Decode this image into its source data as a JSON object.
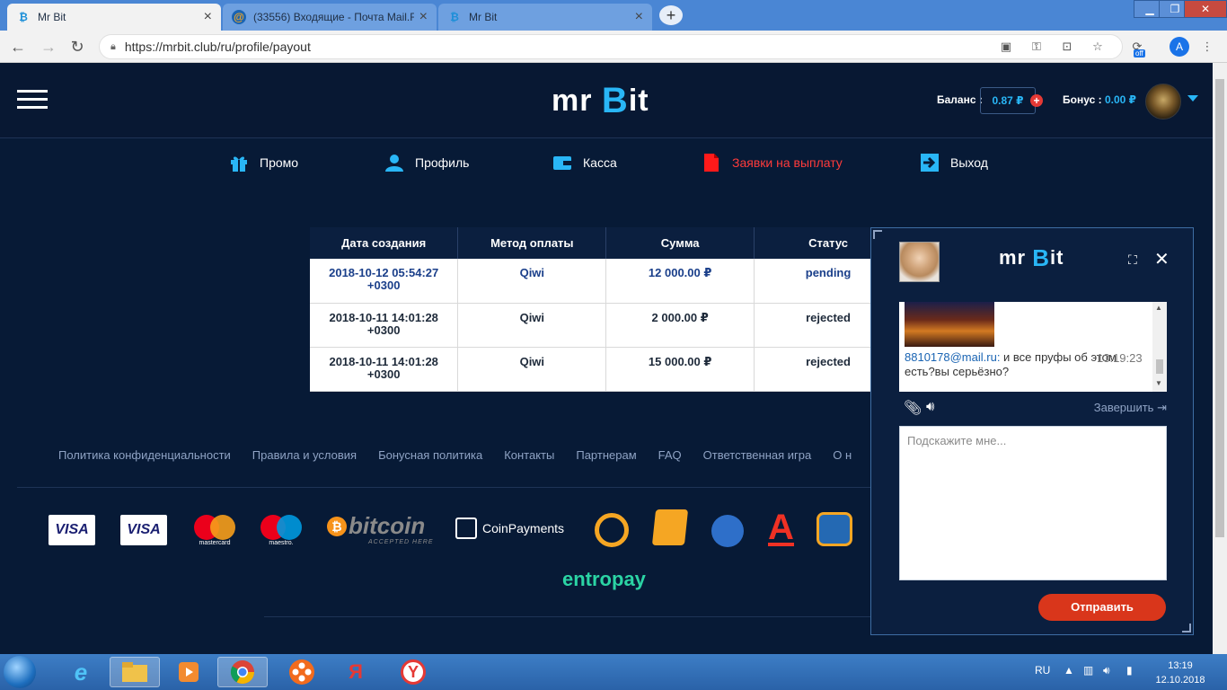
{
  "browser": {
    "tabs": [
      {
        "title": "Mr Bit",
        "icon": "mrbit-favicon",
        "active": true
      },
      {
        "title": "(33556) Входящие - Почта Mail.R",
        "icon": "mail-favicon",
        "active": false
      },
      {
        "title": "Mr Bit",
        "icon": "mrbit-favicon",
        "active": false
      }
    ],
    "url": "https://mrbit.club/ru/profile/payout",
    "profile_initial": "А",
    "ext_badge": "off"
  },
  "header": {
    "logo_prefix": "mr",
    "logo_b": "B",
    "logo_suffix": "it",
    "balance_label": "Баланс :",
    "balance_value": "0.87 ₽",
    "bonus_label": "Бонус :",
    "bonus_value": "0.00 ₽"
  },
  "menu": {
    "items": [
      {
        "label": "Промо",
        "icon": "gift-icon"
      },
      {
        "label": "Профиль",
        "icon": "user-icon"
      },
      {
        "label": "Касса",
        "icon": "wallet-icon"
      },
      {
        "label": "Заявки на выплату",
        "icon": "document-icon",
        "active": true
      },
      {
        "label": "Выход",
        "icon": "logout-icon"
      }
    ],
    "active_color": "#ff3b3b"
  },
  "table": {
    "headers": [
      "Дата создания",
      "Метод оплаты",
      "Сумма",
      "Статус"
    ],
    "rows": [
      {
        "date": "2018-10-12 05:54:27",
        "tz": "+0300",
        "method": "Qiwi",
        "amount": "12 000.00 ₽",
        "status": "pending"
      },
      {
        "date": "2018-10-11 14:01:28",
        "tz": "+0300",
        "method": "Qiwi",
        "amount": "2 000.00 ₽",
        "status": "rejected"
      },
      {
        "date": "2018-10-11 14:01:28",
        "tz": "+0300",
        "method": "Qiwi",
        "amount": "15 000.00 ₽",
        "status": "rejected"
      }
    ]
  },
  "footer": {
    "links": [
      "Политика конфиденциальности",
      "Правила и условия",
      "Бонусная политика",
      "Контакты",
      "Партнерам",
      "FAQ",
      "Ответственная игра",
      "О н"
    ],
    "payment": {
      "visa": "VISA",
      "mastercard": "mastercard",
      "maestro": "maestro.",
      "bitcoin": "bitcoin",
      "bitcoin_sub": "ACCEPTED HERE",
      "coinpayments": "CoinPayments",
      "alfa": "А",
      "entropay": "entropay"
    }
  },
  "chat": {
    "message_sender": "8810178@mail.ru:",
    "message_text": " и все пруфы об этом есть?вы серьёзно?",
    "message_time": "13:19:23",
    "finish_label": "Завершить",
    "input_placeholder": "Подскажите мне...",
    "send_label": "Отправить"
  },
  "taskbar": {
    "lang": "RU",
    "time": "13:19",
    "date": "12.10.2018",
    "yandex_letter": "Я",
    "ybrowser_letter": "Y"
  },
  "colors": {
    "brand_blue": "#29b6f6",
    "page_bg": "#071a36",
    "send_button": "#d9361b"
  }
}
